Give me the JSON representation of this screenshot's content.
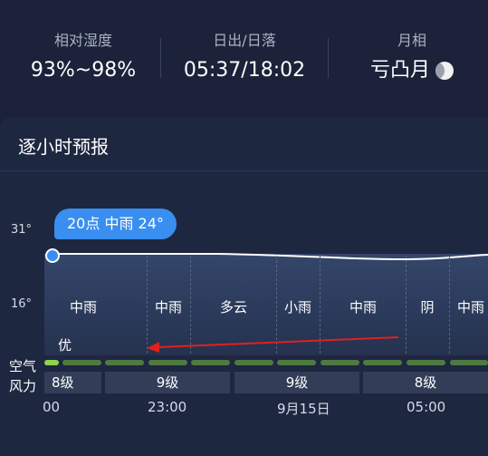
{
  "stats": {
    "humidity": {
      "label": "相对湿度",
      "value": "93%~98%"
    },
    "sun": {
      "label": "日出/日落",
      "value": "05:37/18:02"
    },
    "moon": {
      "label": "月相",
      "value": "亏凸月",
      "icon": "waning-gibbous-moon-icon"
    }
  },
  "hourly": {
    "title": "逐小时预报",
    "y_top": "31°",
    "y_bottom": "16°",
    "tooltip": "20点 中雨 24°",
    "weather": [
      "中雨",
      "中雨",
      "多云",
      "小雨",
      "中雨",
      "阴",
      "中雨"
    ],
    "air_quality_row_label": "空气",
    "wind_row_label": "风力",
    "air_quality_value": "优",
    "wind": [
      "8级",
      "9级",
      "9级",
      "8级"
    ],
    "times": [
      "00",
      "23:00",
      "9月15日",
      "05:00"
    ]
  },
  "colors": {
    "accent": "#3a8ef0",
    "air_quality_good": "#8fd44a",
    "air_quality_bar": "#4f7a43",
    "annotation_arrow": "#e02020"
  }
}
